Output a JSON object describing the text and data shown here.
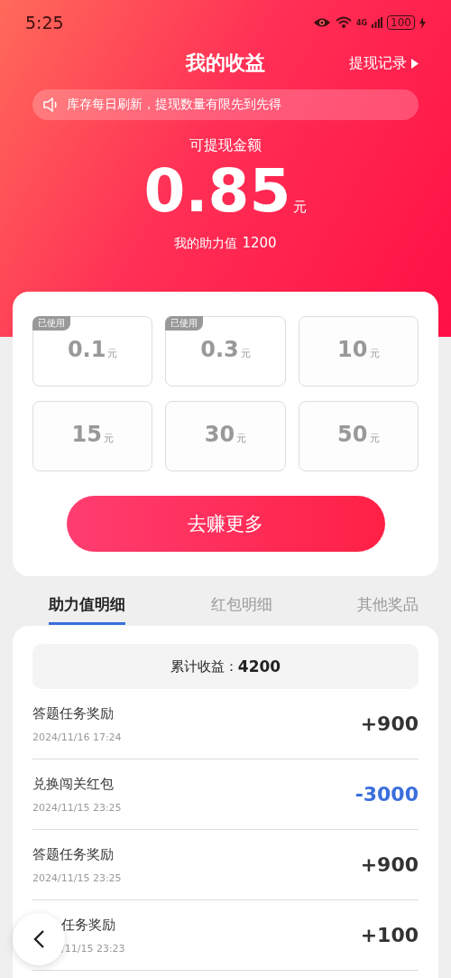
{
  "status_bar": {
    "time": "5:25",
    "battery": "100",
    "network": "4G"
  },
  "header": {
    "title": "我的收益",
    "link": "提现记录"
  },
  "notice": "库存每日刷新，提现数量有限先到先得",
  "balance": {
    "label": "可提现金额",
    "amount": "0.85",
    "unit": "元",
    "help_label": "我的助力值",
    "help_value": "1200"
  },
  "tiles": [
    {
      "amount": "0.1",
      "unit": "元",
      "used": true,
      "badge": "已使用"
    },
    {
      "amount": "0.3",
      "unit": "元",
      "used": true,
      "badge": "已使用"
    },
    {
      "amount": "10",
      "unit": "元",
      "used": false
    },
    {
      "amount": "15",
      "unit": "元",
      "used": false
    },
    {
      "amount": "30",
      "unit": "元",
      "used": false
    },
    {
      "amount": "50",
      "unit": "元",
      "used": false
    }
  ],
  "earn_button": "去赚更多",
  "tabs": [
    {
      "label": "助力值明细",
      "selected": true
    },
    {
      "label": "红包明细",
      "selected": false
    },
    {
      "label": "其他奖品",
      "selected": false
    }
  ],
  "summary": {
    "label": "累计收益：",
    "value": "4200"
  },
  "records": [
    {
      "title": "答题任务奖励",
      "time": "2024/11/16 17:24",
      "amount": "+900",
      "kind": "income"
    },
    {
      "title": "兑换闯关红包",
      "time": "2024/11/15 23:25",
      "amount": "-3000",
      "kind": "expense"
    },
    {
      "title": "答题任务奖励",
      "time": "2024/11/15 23:25",
      "amount": "+900",
      "kind": "income"
    },
    {
      "title": "任务奖励",
      "time": "/11/15 23:23",
      "amount": "+100",
      "kind": "income",
      "covered": true
    }
  ]
}
